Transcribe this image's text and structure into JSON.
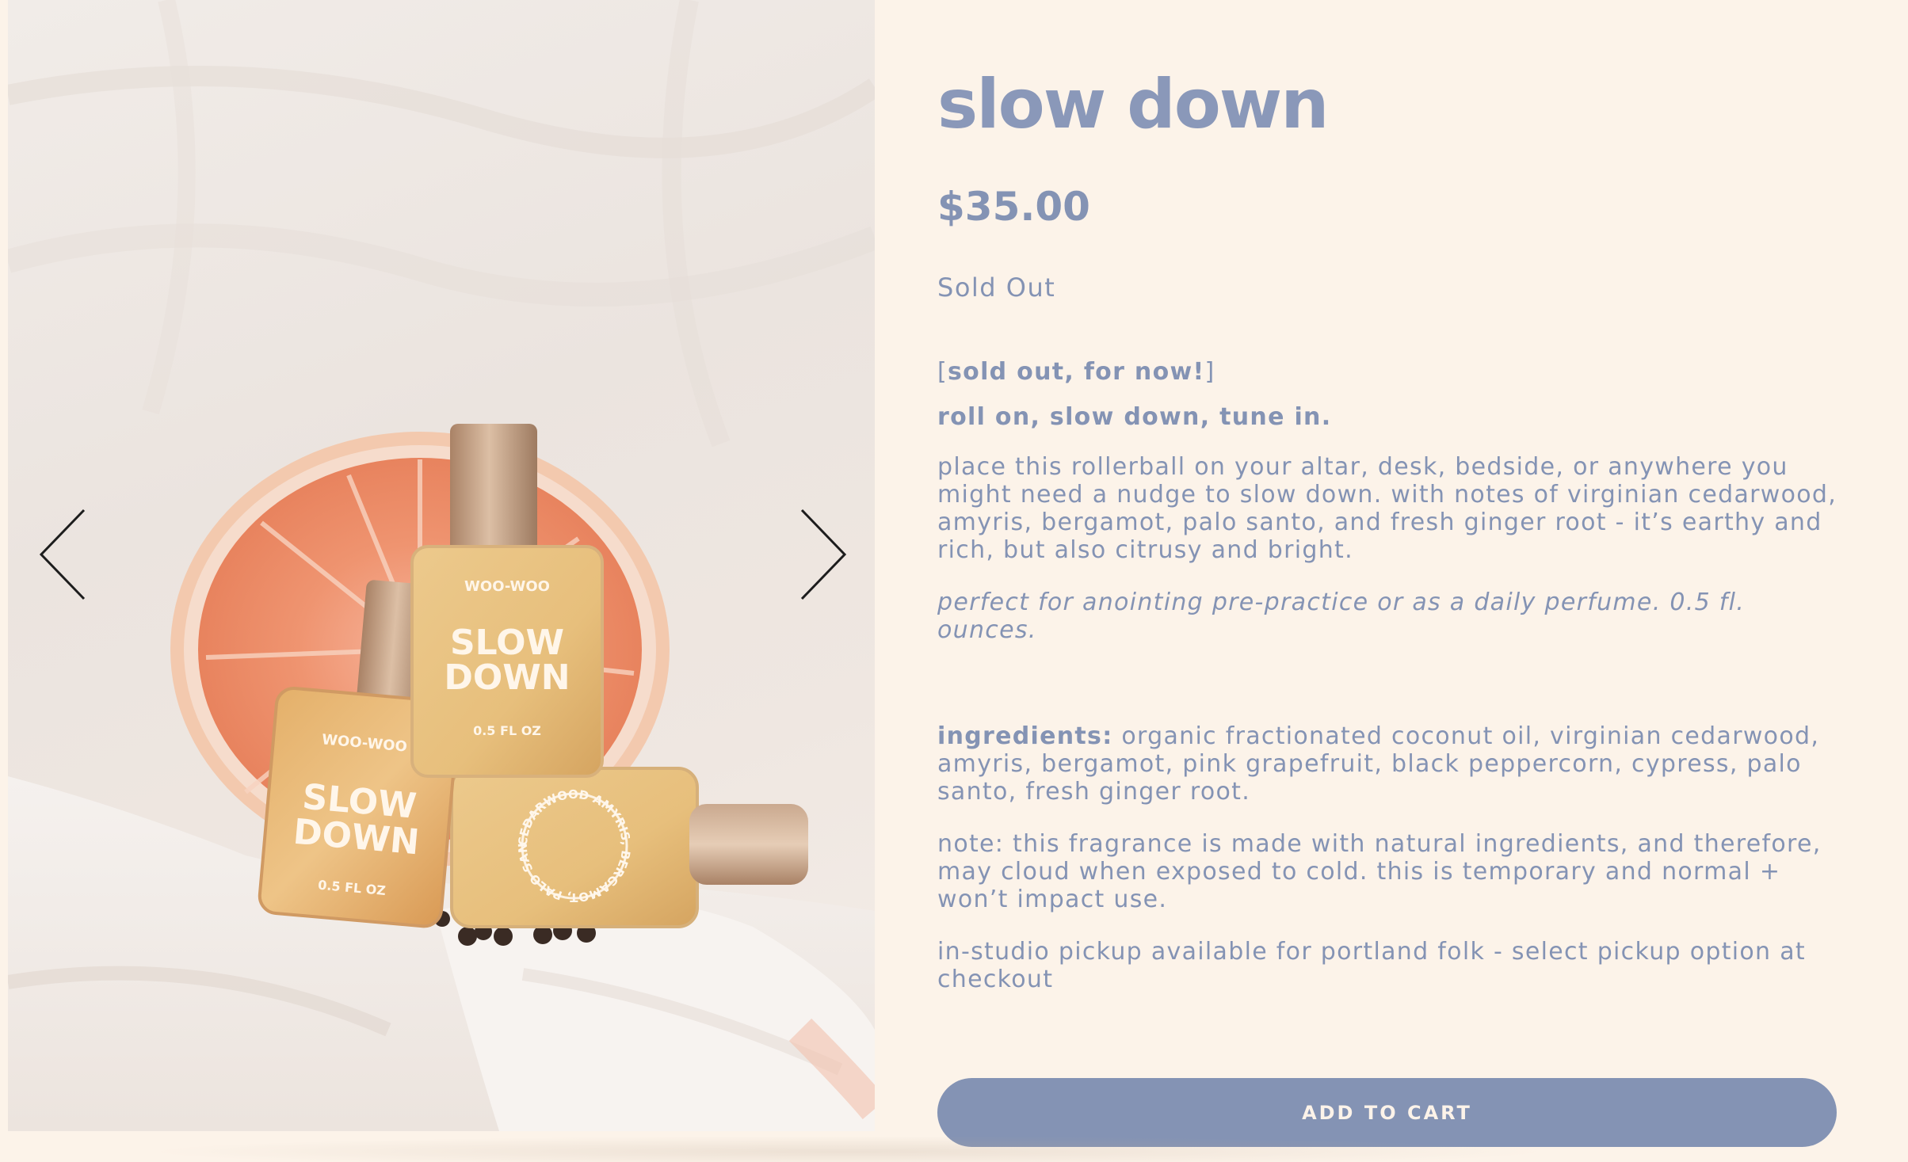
{
  "product": {
    "title": "slow down",
    "price": "$35.00",
    "stock_status": "Sold Out"
  },
  "gallery": {
    "image_alt": "slow down rollerball perfume bottles with grapefruit",
    "bottle_brand": "WOO-WOO",
    "bottle_name_line1": "SLOW",
    "bottle_name_line2": "DOWN",
    "bottle_size": "0.5 FL OZ",
    "bottle_ring_text": "CEDARWOOD AMYRIS, BERGAMOT, PALO SANTO, GINGER",
    "prev_icon": "chevron-left-icon",
    "next_icon": "chevron-right-icon"
  },
  "description": {
    "bracket_open": "[",
    "sold_out_note": "sold out, for now!",
    "bracket_close": "]",
    "tagline": "roll on, slow down, tune in.",
    "body": "place this rollerball on your altar, desk, bedside, or anywhere you might need a nudge to slow down. with notes of virginian cedarwood, amyris, bergamot, palo santo, and fresh ginger root - it’s earthy and rich, but also citrusy and bright.",
    "usage": "perfect for anointing pre-practice or as a daily perfume. 0.5 fl. ounces.",
    "ingredients_label": "ingredients:",
    "ingredients": " organic fractionated coconut oil, virginian cedarwood, amyris, bergamot, pink grapefruit, black peppercorn, cypress, palo santo, fresh ginger root.",
    "note": "note: this fragrance is made with natural ingredients, and therefore, may cloud when exposed to cold. this is temporary and normal + won’t impact use.",
    "pickup": "in-studio pickup available for portland folk - select pickup option at checkout"
  },
  "actions": {
    "add_to_cart": "ADD TO CART"
  },
  "colors": {
    "background": "#fcf3e9",
    "accent": "#8493b4"
  }
}
